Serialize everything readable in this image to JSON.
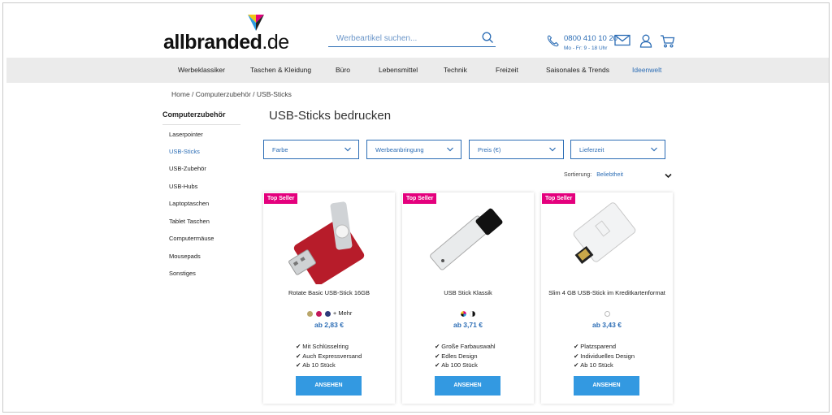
{
  "header": {
    "logo_main": "allbranded",
    "logo_tld": ".de",
    "search_placeholder": "Werbeartikel suchen...",
    "phone_number": "0800 410 10 20",
    "phone_hours": "Mo - Fr: 9 - 18 Uhr"
  },
  "nav": {
    "items": [
      {
        "label": "Werbeklassiker"
      },
      {
        "label": "Taschen & Kleidung"
      },
      {
        "label": "Büro"
      },
      {
        "label": "Lebensmittel"
      },
      {
        "label": "Technik"
      },
      {
        "label": "Freizeit"
      },
      {
        "label": "Saisonales & Trends"
      },
      {
        "label": "Ideenwelt"
      }
    ],
    "active_color": "#2c6db5"
  },
  "breadcrumb": "Home / Computerzubehör / USB-Sticks",
  "sidebar": {
    "title": "Computerzubehör",
    "items": [
      {
        "label": "Laserpointer"
      },
      {
        "label": "USB-Sticks"
      },
      {
        "label": "USB-Zubehör"
      },
      {
        "label": "USB-Hubs"
      },
      {
        "label": "Laptoptaschen"
      },
      {
        "label": "Tablet Taschen"
      },
      {
        "label": "Computermäuse"
      },
      {
        "label": "Mousepads"
      },
      {
        "label": "Sonstiges"
      }
    ]
  },
  "main": {
    "title": "USB-Sticks bedrucken",
    "filters": [
      {
        "label": "Farbe"
      },
      {
        "label": "Werbeanbringung"
      },
      {
        "label": "Preis (€)"
      },
      {
        "label": "Lieferzeit"
      }
    ],
    "sort_label": "Sortierung:",
    "sort_value": "Beliebtheit"
  },
  "products": [
    {
      "badge": "Top Seller",
      "name": "Rotate Basic USB-Stick 16GB",
      "swatch_more": "+ Mehr",
      "price": "ab 2,83 €",
      "features": [
        "Mit Schlüsselring",
        "Auch Expressversand",
        "Ab 10 Stück"
      ],
      "cta": "ANSEHEN"
    },
    {
      "badge": "Top Seller",
      "name": "USB Stick Klassik",
      "price": "ab 3,71 €",
      "features": [
        "Große Farbauswahl",
        "Edles Design",
        "Ab 100 Stück"
      ],
      "cta": "ANSEHEN"
    },
    {
      "badge": "Top Seller",
      "name": "Slim 4 GB USB-Stick im Kreditkartenformat",
      "price": "ab 3,43 €",
      "features": [
        "Platzsparend",
        "Individuelles Design",
        "Ab 10 Stück"
      ],
      "cta": "ANSEHEN"
    }
  ],
  "colors": {
    "accent": "#2c6db5",
    "badge": "#e4007d",
    "button": "#3399e1",
    "nav_bg": "#ebebeb"
  },
  "icons": [
    "logo-mark-icon",
    "search-icon",
    "phone-icon",
    "mail-icon",
    "user-icon",
    "cart-icon",
    "chevron-down-icon",
    "check-icon"
  ]
}
